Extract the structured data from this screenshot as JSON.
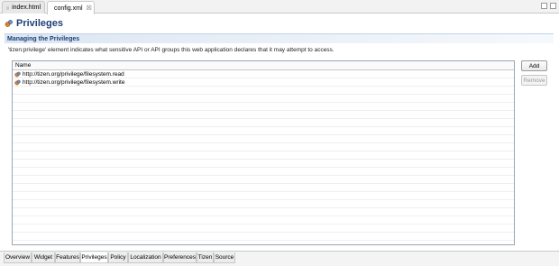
{
  "editor_tabs": [
    {
      "label": "index.html",
      "icon": "html-file-icon",
      "active": false
    },
    {
      "label": "config.xml",
      "icon": "xml-file-icon",
      "active": true,
      "close_glyph": "☒"
    }
  ],
  "page": {
    "title": "Privileges",
    "icon": "privileges-icon"
  },
  "section": {
    "title": "Managing the Privileges",
    "description": "'tizen:privilege' element indicates what sensitive API or API groups this web application declares that it may attempt to access."
  },
  "table": {
    "column_header": "Name",
    "rows": [
      {
        "value": "http://tizen.org/privilege/filesystem.read",
        "icon": "privilege-icon"
      },
      {
        "value": "http://tizen.org/privilege/filesystem.write",
        "icon": "privilege-icon"
      }
    ]
  },
  "buttons": {
    "add": "Add",
    "remove": "Remove"
  },
  "bottom_tabs": [
    "Overview",
    "Widget",
    "Features",
    "Privileges",
    "Policy",
    "Localization",
    "Preferences",
    "Tizen",
    "Source"
  ],
  "active_bottom_tab": "Privileges",
  "colors": {
    "title": "#1e3f78",
    "section_bg": "#dbe6f3"
  }
}
